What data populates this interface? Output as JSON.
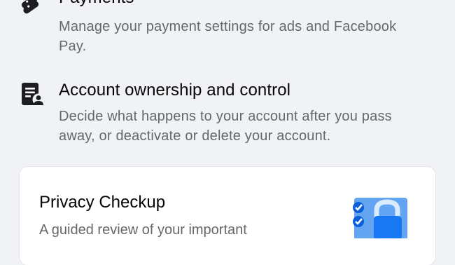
{
  "sections": {
    "payments": {
      "title": "Payments",
      "description": "Manage your payment settings for ads and Facebook Pay.",
      "icon": "tags-icon"
    },
    "account_ownership": {
      "title": "Account ownership and control",
      "description": "Decide what happens to your account after you pass away, or deactivate or delete your account.",
      "icon": "document-person-icon"
    }
  },
  "privacy_checkup": {
    "title": "Privacy Checkup",
    "description": "A guided review of your important",
    "icon": "lock-checklist-illustration"
  }
}
